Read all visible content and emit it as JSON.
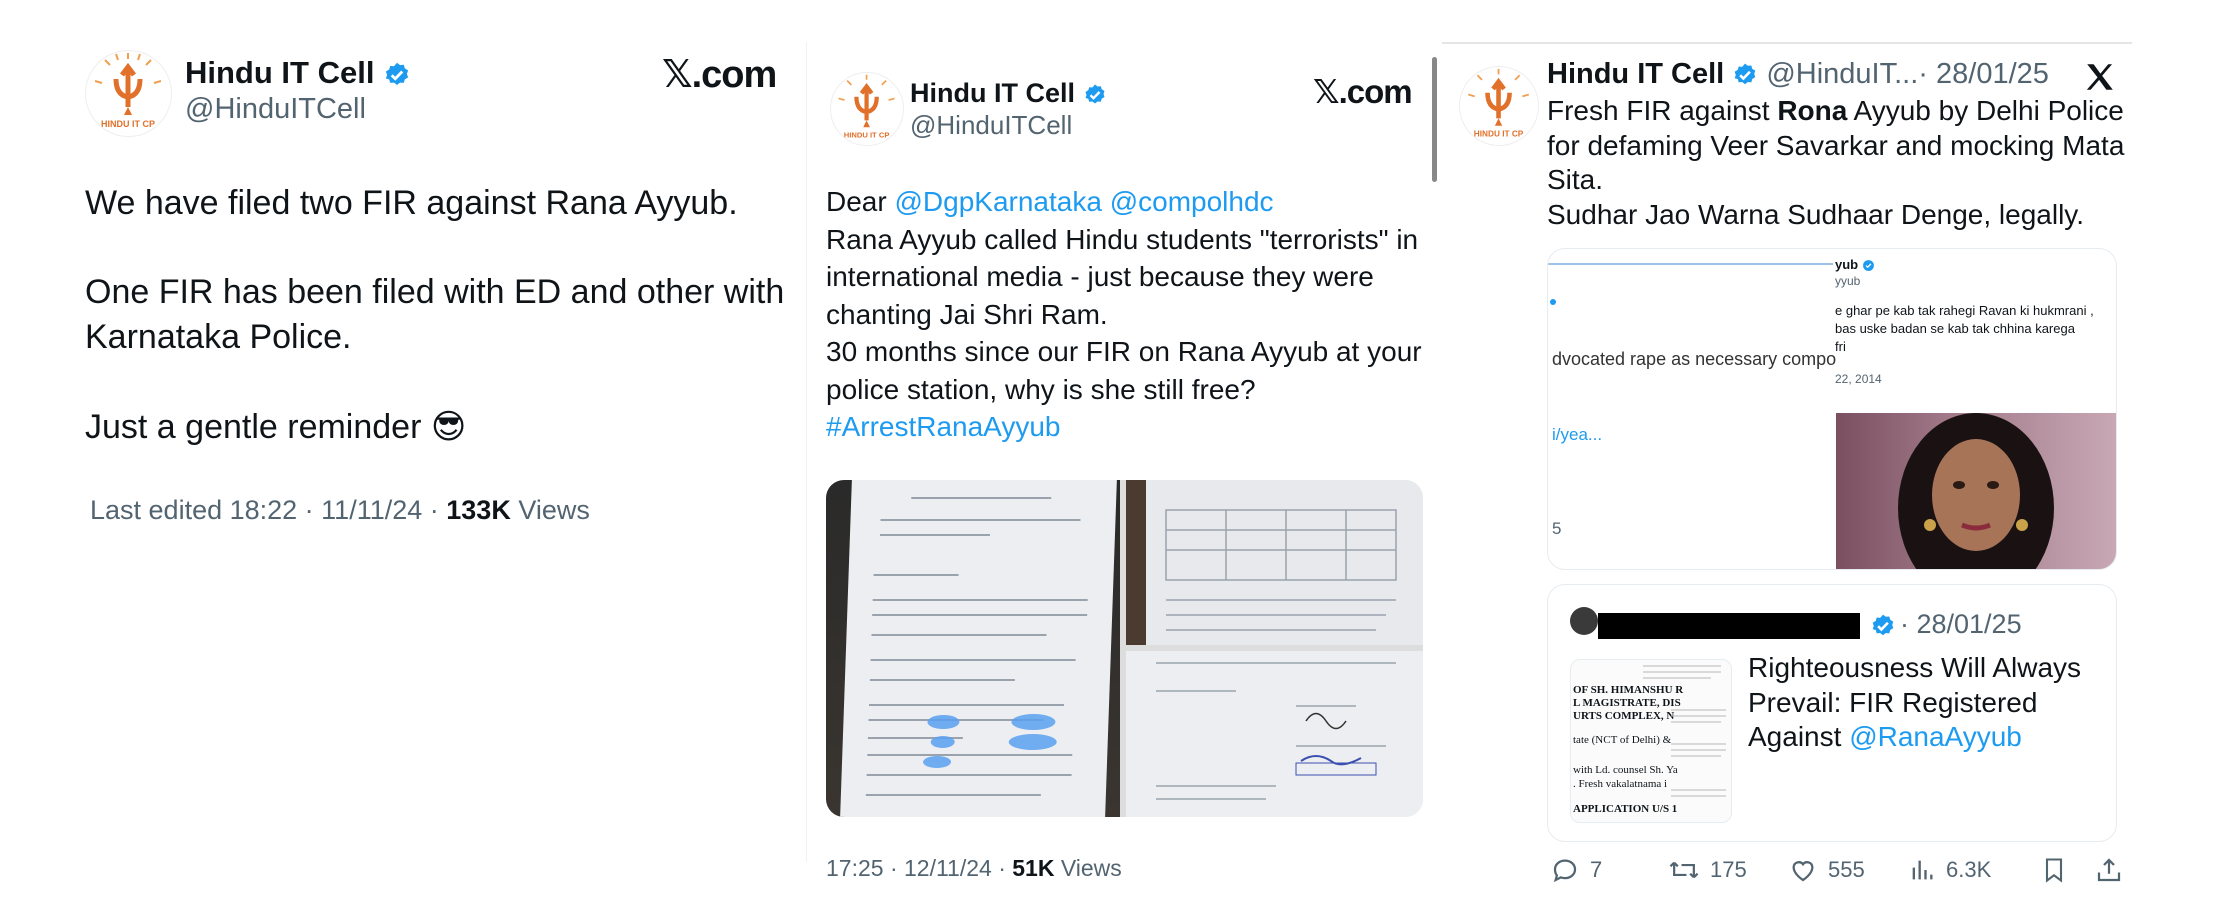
{
  "panel1": {
    "name": "Hindu IT Cell",
    "handle": "@HinduITCell",
    "brand": "𝕏.com",
    "lines": [
      "We have filed two FIR against Rana Ayyub.",
      "One FIR has been filed with ED and other with",
      "Karnataka Police.",
      "Just a gentle reminder 😎"
    ],
    "meta": {
      "edited": "Last edited 18:22 · 11/11/24",
      "sep": " · ",
      "views_count": "133K",
      "views_label": "Views"
    }
  },
  "panel2": {
    "name": "Hindu IT Cell",
    "handle": "@HinduITCell",
    "brand": "𝕏.com",
    "dear": "Dear",
    "mention1": "@DgpKarnataka",
    "mention2": "@compolhdc",
    "body_lines": [
      "Rana Ayyub called Hindu students \"terrorists\" in",
      "international media - just because they were",
      "chanting Jai Shri Ram.",
      "30 months since our FIR on Rana Ayyub at your",
      "police station, why is she still free?"
    ],
    "hashtag": "#ArrestRanaAyyub",
    "meta": {
      "time": "17:25 · 12/11/24 ·",
      "views_count": "51K",
      "views_label": "Views"
    }
  },
  "panel3": {
    "name": "Hindu IT Cell",
    "handle": "@HinduIT...",
    "date": "· 28/01/25",
    "text_pre": "Fresh FIR against",
    "text_bold": "Rona",
    "text_post": "Ayyub by Delhi Police",
    "lines": [
      "for defaming Veer Savarkar and mocking Mata",
      "Sita.",
      "Sudhar Jao Warna Sudhaar Denge, legally."
    ],
    "embed": {
      "handle": "yub",
      "handle2": "yyub",
      "quote_lines": [
        "e ghar pe kab tak rahegi Ravan ki hukmrani ,",
        "bas uske badan se kab tak chhina karega",
        "fri"
      ],
      "left_text": "dvocated rape as necessary compo",
      "date": "22, 2014",
      "link": "i/yea...",
      "num": "5"
    },
    "quote": {
      "date": "· 28/01/25",
      "title_lines": [
        "Righteousness Will Always",
        "Prevail: FIR Registered",
        "Against"
      ],
      "mention": "@RanaAyyub",
      "doc_lines": [
        "OF SH. HIMANSHU R",
        "L MAGISTRATE, DIS",
        "URTS COMPLEX, N",
        "tate (NCT of Delhi) &",
        "with Ld. counsel Sh. Ya",
        ". Fresh vakalatnama i",
        "APPLICATION U/S 1"
      ]
    },
    "actions": {
      "replies": "7",
      "reposts": "175",
      "likes": "555",
      "views": "6.3K"
    }
  },
  "colors": {
    "link": "#1d9bf0",
    "muted": "#536471",
    "text": "#0f1419",
    "verified": "#1d9bf0",
    "logo_orange": "#e0702a"
  }
}
